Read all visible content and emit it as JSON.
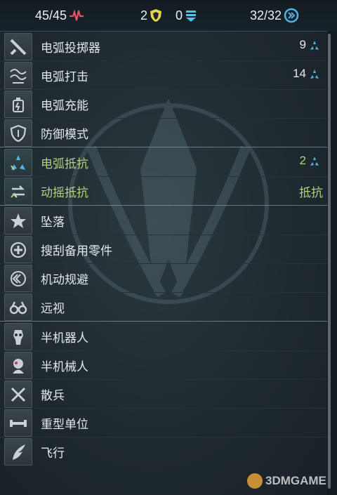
{
  "stats": {
    "health": "45/45",
    "armor": "2",
    "shield": "0",
    "cooldown": "32/32"
  },
  "traits": [
    {
      "label": "电弧投掷器",
      "value": "9",
      "value_icon": "arc-resist-icon",
      "style": "normal",
      "icon": "arc-thrower-icon"
    },
    {
      "label": "电弧打击",
      "value": "14",
      "value_icon": "arc-resist-icon",
      "style": "normal",
      "icon": "arc-strike-icon"
    },
    {
      "label": "电弧充能",
      "value": "",
      "style": "normal",
      "icon": "arc-charge-icon"
    },
    {
      "label": "防御模式",
      "value": "",
      "style": "normal",
      "icon": "defense-mode-icon"
    },
    {
      "label": "电弧抵抗",
      "value": "2",
      "value_icon": "arc-resist-icon",
      "style": "green",
      "icon": "arc-resist-icon"
    },
    {
      "label": "动摇抵抗",
      "value": "抵抗",
      "style": "green",
      "icon": "stagger-resist-icon"
    },
    {
      "label": "坠落",
      "value": "",
      "style": "normal",
      "icon": "fall-icon"
    },
    {
      "label": "搜刮备用零件",
      "value": "",
      "style": "normal",
      "icon": "scavenge-parts-icon"
    },
    {
      "label": "机动规避",
      "value": "",
      "style": "normal",
      "icon": "evasion-icon"
    },
    {
      "label": "远视",
      "value": "",
      "style": "normal",
      "icon": "binoculars-icon"
    },
    {
      "label": "半机器人",
      "value": "",
      "style": "normal",
      "icon": "cyborg-icon"
    },
    {
      "label": "半机械人",
      "value": "",
      "style": "normal",
      "icon": "android-icon"
    },
    {
      "label": "散兵",
      "value": "",
      "style": "normal",
      "icon": "skirmisher-icon"
    },
    {
      "label": "重型单位",
      "value": "",
      "style": "normal",
      "icon": "heavy-unit-icon"
    },
    {
      "label": "飞行",
      "value": "",
      "style": "normal",
      "icon": "flight-icon"
    }
  ],
  "watermark": "3DMGAME",
  "colors": {
    "health_icon": "#e8506b",
    "armor_icon": "#e2d64a",
    "shield_icon": "#4fc3e8",
    "cooldown_icon": "#4fb4e8",
    "green_text": "#b6cf7a"
  }
}
